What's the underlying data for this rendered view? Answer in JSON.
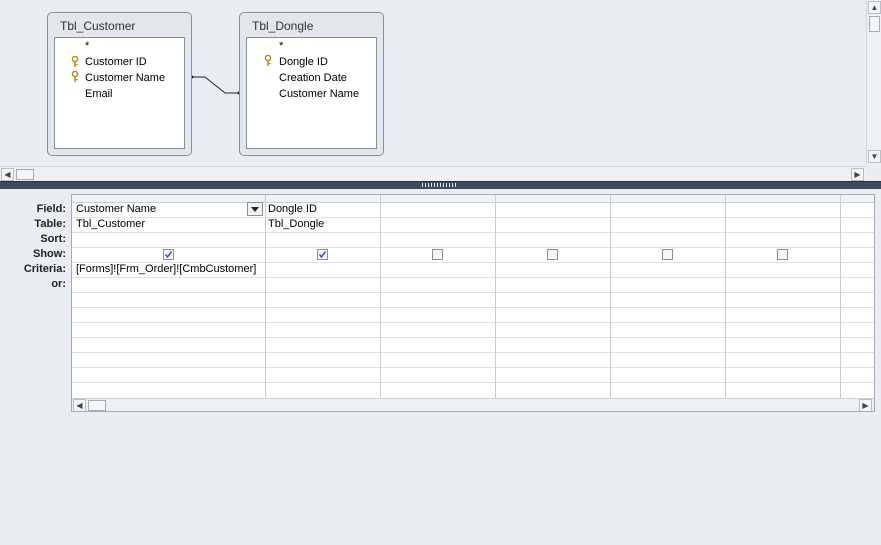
{
  "tables": [
    {
      "title": "Tbl_Customer",
      "fields": [
        {
          "name": "*",
          "key": false
        },
        {
          "name": "Customer ID",
          "key": true
        },
        {
          "name": "Customer Name",
          "key": true
        },
        {
          "name": "Email",
          "key": false
        }
      ]
    },
    {
      "title": "Tbl_Dongle",
      "fields": [
        {
          "name": "*",
          "key": false
        },
        {
          "name": "Dongle ID",
          "key": true
        },
        {
          "name": "Creation Date",
          "key": false
        },
        {
          "name": "Customer Name",
          "key": false
        }
      ]
    }
  ],
  "grid": {
    "row_labels": {
      "field": "Field:",
      "table": "Table:",
      "sort": "Sort:",
      "show": "Show:",
      "criteria": "Criteria:",
      "or": "or:"
    },
    "columns": [
      {
        "field": "Customer Name",
        "table": "Tbl_Customer",
        "sort": "",
        "show": true,
        "criteria": "[Forms]![Frm_Order]![CmbCustomer]",
        "or": ""
      },
      {
        "field": "Dongle ID",
        "table": "Tbl_Dongle",
        "sort": "",
        "show": true,
        "criteria": "",
        "or": ""
      },
      {
        "field": "",
        "table": "",
        "sort": "",
        "show": false,
        "criteria": "",
        "or": ""
      },
      {
        "field": "",
        "table": "",
        "sort": "",
        "show": false,
        "criteria": "",
        "or": ""
      },
      {
        "field": "",
        "table": "",
        "sort": "",
        "show": false,
        "criteria": "",
        "or": ""
      },
      {
        "field": "",
        "table": "",
        "sort": "",
        "show": false,
        "criteria": "",
        "or": ""
      }
    ]
  },
  "icons": {
    "key": "primary-key-icon",
    "dropdown": "dropdown-arrow-icon",
    "check": "checkmark-icon"
  }
}
